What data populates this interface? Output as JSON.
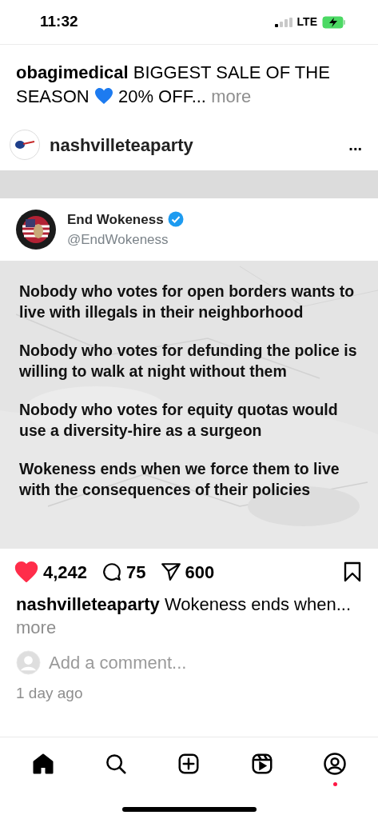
{
  "status_bar": {
    "time": "11:32",
    "network": "LTE"
  },
  "previous_post": {
    "username": "obagimedical",
    "caption_start": [
      "BIGGEST SALE OF THE",
      "SEASON"
    ],
    "caption_end": "20% OFF...",
    "more": "more"
  },
  "post": {
    "username": "nashvilleteaparty",
    "menu": "...",
    "tweet": {
      "name": "End Wokeness",
      "verified": true,
      "handle": "@EndWokeness",
      "paragraphs": [
        "Nobody who votes for open borders wants to live with illegals in their neighborhood",
        "Nobody who votes for defunding the police is willing to walk at night without them",
        "Nobody who votes for equity quotas would use a diversity-hire as a surgeon",
        "Wokeness ends when we force them to live with the consequences of their policies"
      ]
    },
    "liked": true,
    "likes": "4,242",
    "comments": "75",
    "shares": "600",
    "saved": false,
    "caption_user": "nashvilleteaparty",
    "caption": "Wokeness ends when...",
    "more": "more",
    "comment_placeholder": "Add a comment...",
    "time": "1 day ago"
  },
  "nav": [
    {
      "kind": "home",
      "selected": true
    },
    {
      "kind": "search",
      "selected": false
    },
    {
      "kind": "create",
      "selected": false
    },
    {
      "kind": "reels",
      "selected": false
    },
    {
      "kind": "profile",
      "selected": false,
      "notification": true
    }
  ]
}
